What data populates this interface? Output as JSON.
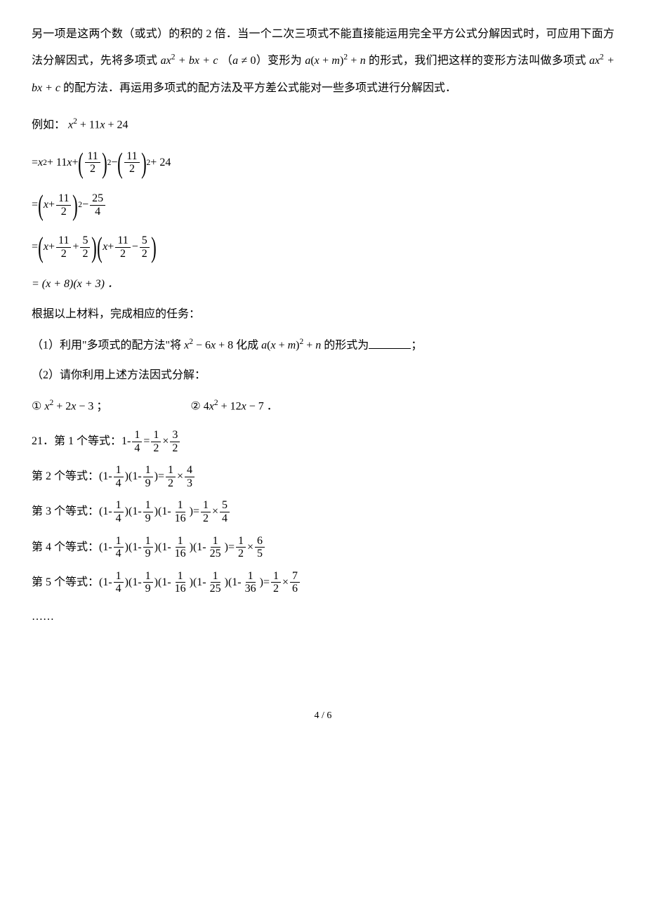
{
  "p1": {
    "t1": "另一项是这两个数（或式）的积的 2 倍．当一个二次三项式不能直接能运用完全平方公式分解因式时，可应用下面方法分解因式，先将多项式 ",
    "m1a": "ax",
    "m1b": "2",
    "m1c": " + bx + c",
    "t2": "（",
    "m2a": "a",
    "m2b": " ≠ 0",
    "t3": "）变形为 ",
    "m3a": "a",
    "m3b": "(",
    "m3c": "x",
    "m3d": " + ",
    "m3e": "m",
    "m3f": ")",
    "m3g": "2",
    "m3h": " + ",
    "m3i": "n",
    "t4": " 的形式，我们把这样的变形方法叫做多项式 ",
    "m4a": "ax",
    "m4b": "2",
    "m4c": " + bx + c",
    "t5": " 的配方法．再运用多项式的配方法及平方差公式能对一些多项式进行分解因式．"
  },
  "example": {
    "label": "例如：",
    "expr_x2": "x",
    "expr_sq": "2",
    "expr_plus1": " + 11",
    "expr_x": "x",
    "expr_plus2": " + 24"
  },
  "step1": {
    "pre": "= ",
    "x": "x",
    "sq": "2",
    "p1": " + 11",
    "x2": "x",
    "p2": " + ",
    "f1n": "11",
    "f1d": "2",
    "exp1": "2",
    "minus": " − ",
    "f2n": "11",
    "f2d": "2",
    "exp2": "2",
    "tail": " + 24"
  },
  "step2": {
    "pre": "= ",
    "x": "x",
    "plus": " + ",
    "f1n": "11",
    "f1d": "2",
    "exp": "2",
    "minus": " − ",
    "f2n": "25",
    "f2d": "4"
  },
  "step3": {
    "pre": "= ",
    "x1": "x",
    "p1": " + ",
    "f1n": "11",
    "f1d": "2",
    "p2": " + ",
    "f2n": "5",
    "f2d": "2",
    "x2": "x",
    "p3": " + ",
    "f3n": "11",
    "f3d": "2",
    "p4": " − ",
    "f4n": "5",
    "f4d": "2"
  },
  "step4": {
    "text": "= (x + 8)(x + 3) ．"
  },
  "followup": "根据以上材料，完成相应的任务：",
  "q1": {
    "lead": "（1）利用\"多项式的配方法\"将 ",
    "ma": "x",
    "mb": "2",
    "mc": " − 6",
    "md": "x",
    "me": " + 8",
    "mid": " 化成 ",
    "na": "a",
    "nb": "(",
    "nc": "x",
    "nd": " + ",
    "ne": "m",
    "nf": ")",
    "ng": "2",
    "nh": " + ",
    "ni": "n",
    "tail": " 的形式为",
    "semi": "；"
  },
  "q2": {
    "lead": "（2）请你利用上述方法因式分解：",
    "c1": "①",
    "e1a": "x",
    "e1b": "2",
    "e1c": " + 2",
    "e1d": "x",
    "e1e": " − 3",
    "semi1": "；",
    "c2": "②",
    "e2a": " 4",
    "e2b": "x",
    "e2c": "2",
    "e2d": " + 12",
    "e2e": "x",
    "e2f": " − 7",
    "dot": "．"
  },
  "p21": {
    "label": "21．",
    "head1": "第 1 个等式：",
    "head2": "第 2 个等式：",
    "head3": "第 3 个等式：",
    "head4": "第 4 个等式：",
    "head5": "第 5 个等式：",
    "one": "1",
    "minus": "-",
    "eq": "=",
    "times": "×",
    "f4n": "1",
    "f4d": "4",
    "f9n": "1",
    "f9d": "9",
    "f16n": "1",
    "f16d": "16",
    "f25n": "1",
    "f25d": "25",
    "f36n": "1",
    "f36d": "36",
    "r1an": "1",
    "r1ad": "2",
    "r1bn": "3",
    "r1bd": "2",
    "r2an": "1",
    "r2ad": "2",
    "r2bn": "4",
    "r2bd": "3",
    "r3an": "1",
    "r3ad": "2",
    "r3bn": "5",
    "r3bd": "4",
    "r4an": "1",
    "r4ad": "2",
    "r4bn": "6",
    "r4bd": "5",
    "r5an": "1",
    "r5ad": "2",
    "r5bn": "7",
    "r5bd": "6",
    "ell": "……"
  },
  "footer": {
    "page": "4 / 6"
  }
}
